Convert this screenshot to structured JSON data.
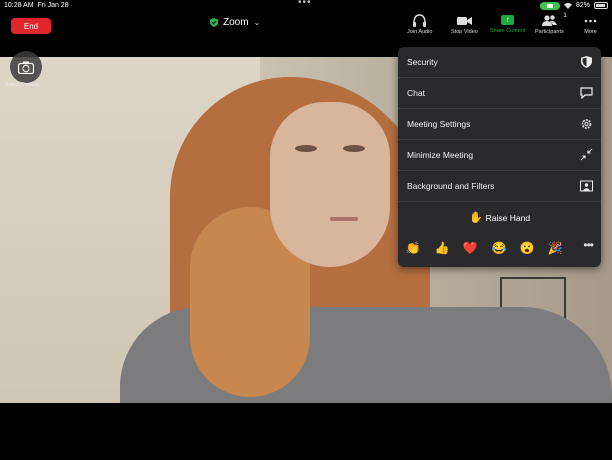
{
  "status_bar": {
    "time": "10:28 AM",
    "date": "Fri Jan 28",
    "battery": "82%"
  },
  "toolbar": {
    "end_label": "End",
    "meeting_title": "Zoom",
    "join_audio": "Join Audio",
    "stop_video": "Stop Video",
    "share_content": "Share Content",
    "participants": "Participants",
    "participants_count": "1",
    "more": "More"
  },
  "video": {
    "switch_camera_label": "Switch Camera"
  },
  "menu": {
    "items": [
      {
        "label": "Security",
        "icon": "shield-icon"
      },
      {
        "label": "Chat",
        "icon": "chat-icon"
      },
      {
        "label": "Meeting Settings",
        "icon": "gear-icon"
      },
      {
        "label": "Minimize Meeting",
        "icon": "minimize-icon"
      },
      {
        "label": "Background and Filters",
        "icon": "background-icon"
      }
    ],
    "raise_hand": "Raise Hand",
    "reactions": [
      "👏",
      "👍",
      "❤️",
      "😂",
      "😮",
      "🎉"
    ]
  },
  "colors": {
    "end_button": "#e0262b",
    "share_green": "#1fa83c",
    "menu_bg": "#2a2a2c"
  }
}
